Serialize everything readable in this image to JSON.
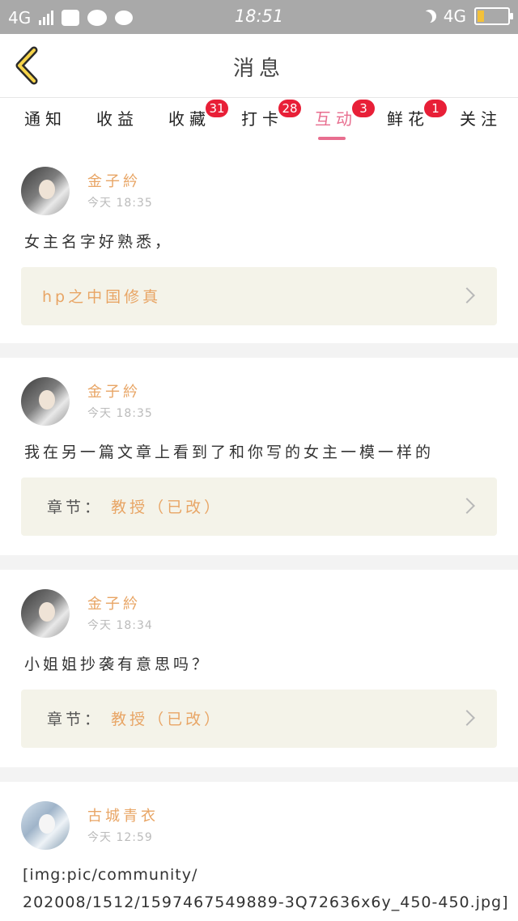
{
  "status_bar": {
    "network_left": "4G",
    "time": "18:51",
    "network_right": "4G"
  },
  "header": {
    "title": "消息",
    "back_icon": "chevron-left-icon"
  },
  "tabs": [
    {
      "label": "通知",
      "badge": ""
    },
    {
      "label": "收益",
      "badge": ""
    },
    {
      "label": "收藏",
      "badge": "31"
    },
    {
      "label": "打卡",
      "badge": "28"
    },
    {
      "label": "互动",
      "badge": "3"
    },
    {
      "label": "鲜花",
      "badge": "1"
    },
    {
      "label": "关注",
      "badge": ""
    }
  ],
  "active_tab": "互动",
  "colors": {
    "accent": "#e86e8f",
    "name": "#e8a565",
    "badge": "#e81f37",
    "link_bg": "#f4f3e9"
  },
  "messages": [
    {
      "user": "金子紟",
      "time": "今天 18:35",
      "text": "女主名字好熟悉，",
      "link_label": "",
      "link_value": "hp之中国修真"
    },
    {
      "user": "金子紟",
      "time": "今天 18:35",
      "text": "我在另一篇文章上看到了和你写的女主一模一样的",
      "link_label": "章节：",
      "link_value": "教授（已改）"
    },
    {
      "user": "金子紟",
      "time": "今天 18:34",
      "text": "小姐姐抄袭有意思吗？",
      "link_label": "章节：",
      "link_value": "教授（已改）"
    },
    {
      "user": "古城青衣",
      "time": "今天 12:59",
      "text_line1": "[img:pic/community/",
      "text_line2": "202008/1512/1597467549889-3Q72636x6y_450-450.jpg]"
    }
  ]
}
